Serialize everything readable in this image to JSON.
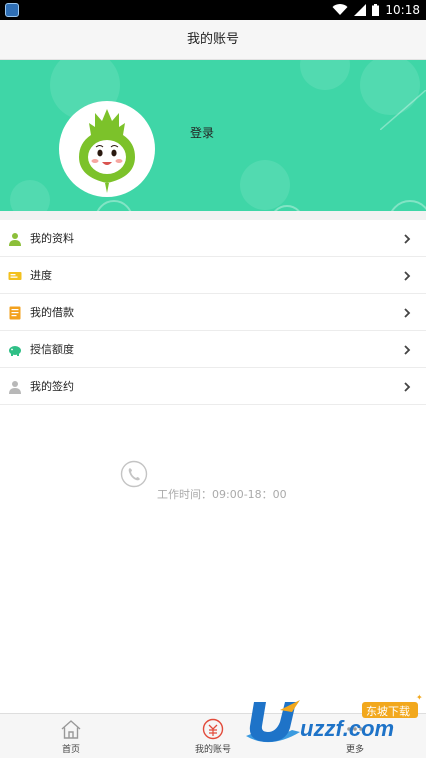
{
  "status_bar": {
    "time": "10:18"
  },
  "header": {
    "title": "我的账号"
  },
  "profile": {
    "login_label": "登录"
  },
  "menu": {
    "items": [
      {
        "label": "我的资料",
        "icon": "person-icon"
      },
      {
        "label": "进度",
        "icon": "ticket-icon"
      },
      {
        "label": "我的借款",
        "icon": "document-icon"
      },
      {
        "label": "授信额度",
        "icon": "piggy-bank-icon"
      },
      {
        "label": "我的签约",
        "icon": "user-icon"
      }
    ]
  },
  "contact": {
    "hours": "工作时间：09:00-18：00"
  },
  "tabbar": {
    "tabs": [
      {
        "label": "首页",
        "icon": "home-icon"
      },
      {
        "label": "我的账号",
        "icon": "account-icon"
      },
      {
        "label": "更多",
        "icon": "more-icon"
      }
    ]
  },
  "watermark": {
    "text": "uzzf.com",
    "badge": "东坡下载"
  },
  "colors": {
    "accent": "#3fd6a7",
    "avatar_mascot": "#7cc22a",
    "tab_active": "#e24a3a"
  }
}
